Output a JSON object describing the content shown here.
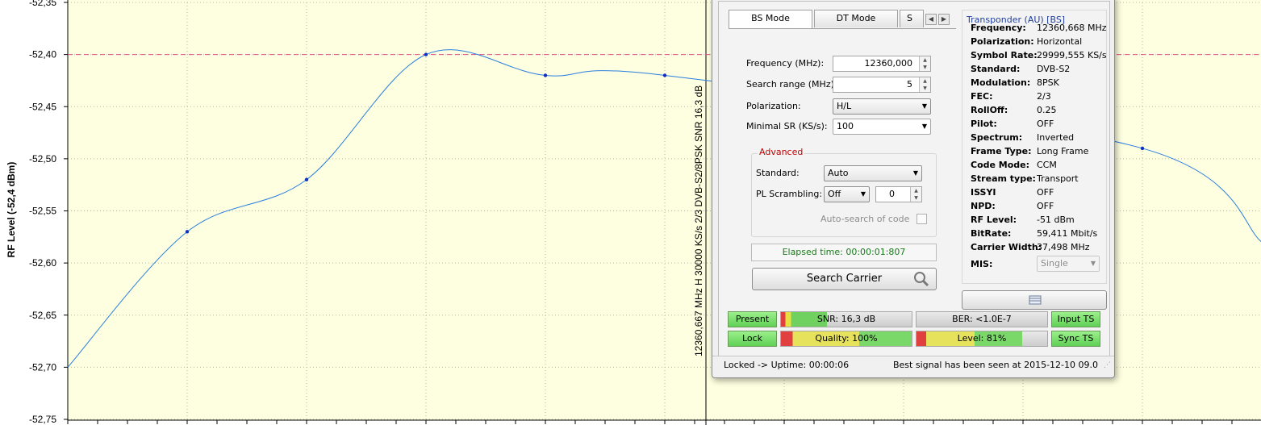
{
  "chart_data": {
    "type": "line",
    "title": "",
    "xlabel": "",
    "ylabel": "RF Level (-52,4 dBm)",
    "ylim": [
      -52.75,
      -52.35
    ],
    "yticks": [
      "-52,35",
      "-52,40",
      "-52,45",
      "-52,50",
      "-52,55",
      "-52,60",
      "-52,65",
      "-52,70",
      "-52,75"
    ],
    "reference_line": -52.4,
    "grid": true,
    "marker_label": "12360,667 MHz H 30000 KS/s 2/3 DVB-S2/8PSK SNR 16,3 dB",
    "x": [
      0,
      1,
      2,
      3,
      4,
      5,
      6,
      7,
      8,
      9,
      10
    ],
    "series": [
      {
        "values": [
          -52.7,
          -52.57,
          -52.52,
          -52.4,
          -52.42,
          -52.42,
          null,
          null,
          null,
          -52.49,
          -52.58
        ]
      }
    ],
    "colors": {
      "line": "#2a7fe0",
      "reference": "#e0508a",
      "background": "#fefee0"
    }
  },
  "dialog": {
    "tabs": [
      "BS Mode",
      "DT Mode",
      "S"
    ],
    "form": {
      "frequency_label": "Frequency (MHz):",
      "frequency_value": "12360,000",
      "search_range_label": "Search range (MHz):",
      "search_range_value": "5",
      "polarization_label": "Polarization:",
      "polarization_value": "H/L",
      "minimal_sr_label": "Minimal SR (KS/s):",
      "minimal_sr_value": "100"
    },
    "advanced": {
      "title": "Advanced",
      "standard_label": "Standard:",
      "standard_value": "Auto",
      "pl_label": "PL Scrambling:",
      "pl_value": "Off",
      "pl_number": "0",
      "autosearch_label": "Auto-search of code"
    },
    "elapsed": "Elapsed time: 00:00:01:807",
    "search_button": "Search Carrier",
    "transponder": {
      "title": "Transponder (AU) [BS]",
      "rows": [
        {
          "key": "Frequency:",
          "value": "12360,668 MHz"
        },
        {
          "key": "Polarization:",
          "value": "Horizontal"
        },
        {
          "key": "Symbol Rate:",
          "value": "29999,555 KS/s"
        },
        {
          "key": "Standard:",
          "value": "DVB-S2"
        },
        {
          "key": "Modulation:",
          "value": "8PSK"
        },
        {
          "key": "FEC:",
          "value": "2/3"
        },
        {
          "key": "RollOff:",
          "value": "0.25"
        },
        {
          "key": "Pilot:",
          "value": "OFF"
        },
        {
          "key": "Spectrum:",
          "value": "Inverted"
        },
        {
          "key": "Frame Type:",
          "value": "Long Frame"
        },
        {
          "key": "Code Mode:",
          "value": "CCM"
        },
        {
          "key": "Stream type:",
          "value": "Transport"
        },
        {
          "key": "ISSYI",
          "value": "OFF"
        },
        {
          "key": "NPD:",
          "value": "OFF"
        },
        {
          "key": "RF Level:",
          "value": "-51 dBm"
        },
        {
          "key": "BitRate:",
          "value": "59,411 Mbit/s"
        },
        {
          "key": "Carrier Width:",
          "value": "37,498 MHz"
        }
      ],
      "mis_label": "MIS:",
      "mis_value": "Single"
    },
    "status": {
      "present": "Present",
      "lock": "Lock",
      "snr": "SNR: 16,3 dB",
      "ber": "BER: <1.0E-7",
      "quality": "Quality: 100%",
      "level": "Level: 81%",
      "input_ts": "Input TS",
      "sync_ts": "Sync TS",
      "snr_fraction": 0.35,
      "quality_fraction": 1.0,
      "level_fraction": 0.81
    },
    "statusbar": {
      "left": "Locked -> Uptime: 00:00:06",
      "right": "Best signal has been seen at 2015-12-10 09.0"
    }
  }
}
